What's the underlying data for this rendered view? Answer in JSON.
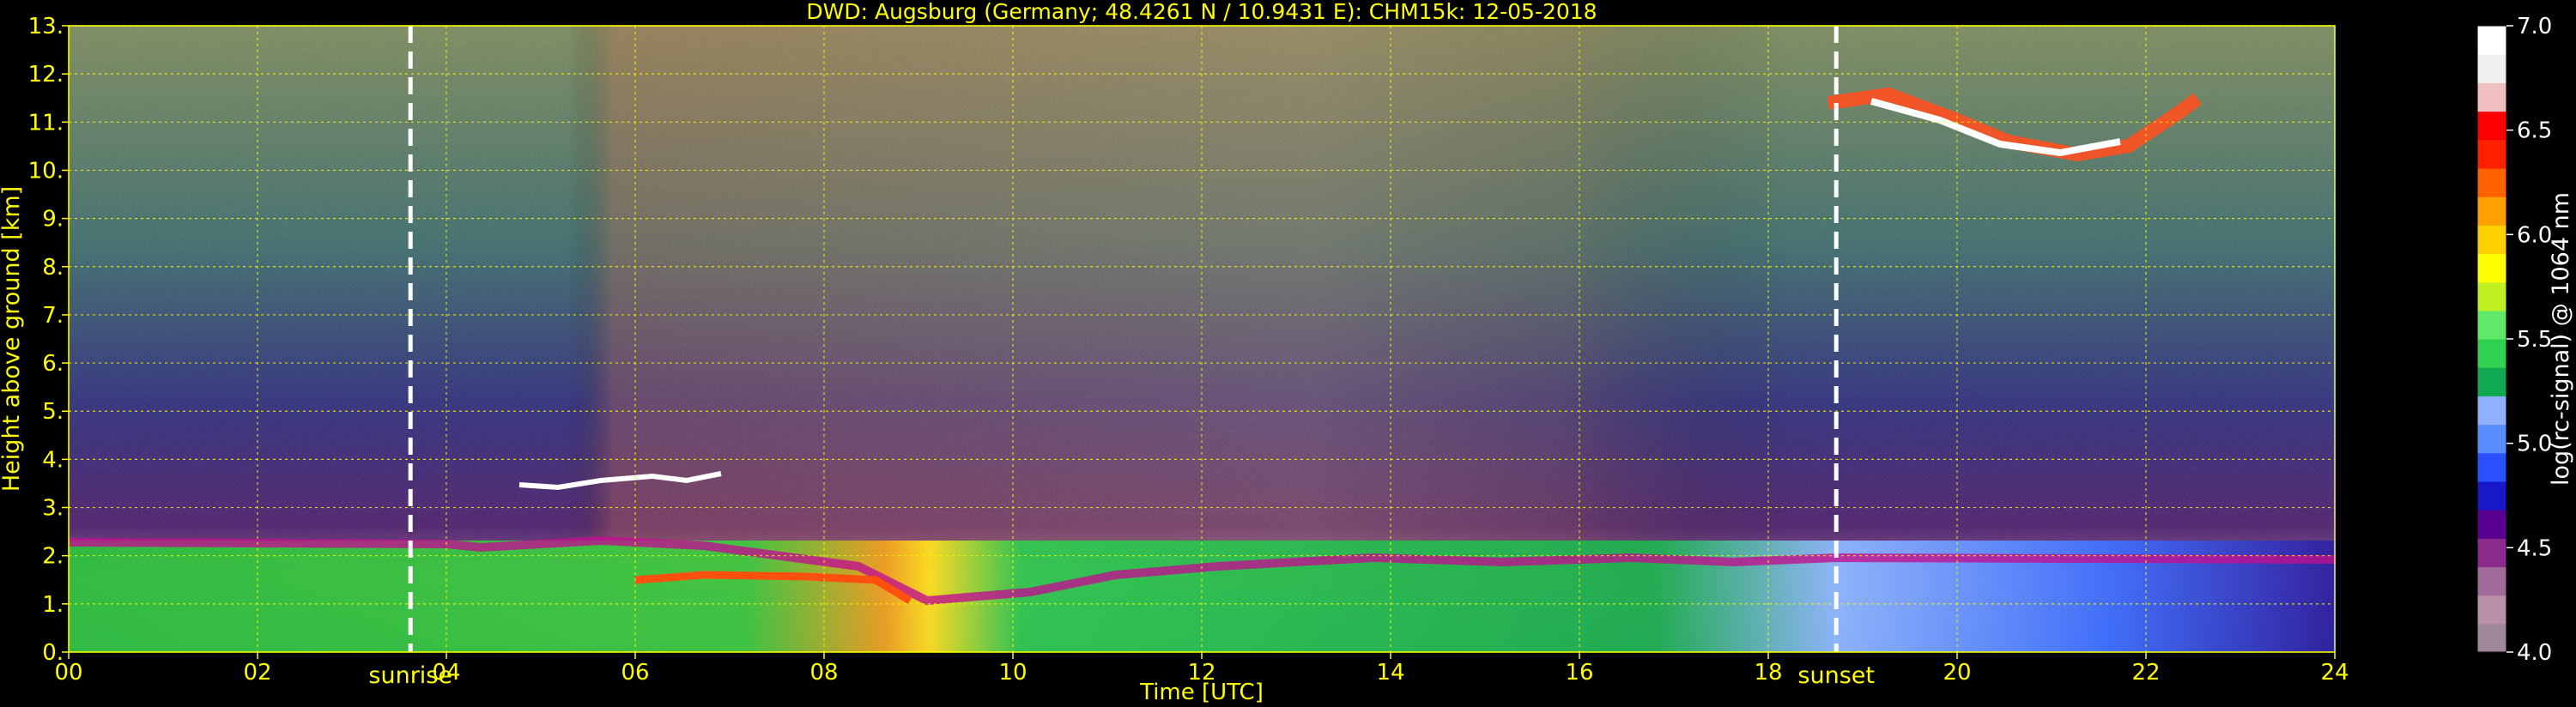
{
  "chart_data": {
    "type": "heatmap",
    "title": "DWD: Augsburg (Germany; 48.4261 N / 10.9431 E):    CHM15k: 12-05-2018",
    "xlabel": "Time [UTC]",
    "ylabel": "Height above ground [km]",
    "colorbar_label": "log(rc-signal) @ 1064 nm",
    "xlim": [
      0,
      24
    ],
    "ylim": [
      0,
      13
    ],
    "x_ticks": [
      "00",
      "02",
      "04",
      "06",
      "08",
      "10",
      "12",
      "14",
      "16",
      "18",
      "20",
      "22",
      "24"
    ],
    "y_ticks": [
      "0.",
      "1.",
      "2.",
      "3.",
      "4.",
      "5.",
      "6.",
      "7.",
      "8.",
      "9.",
      "10.",
      "11.",
      "12.",
      "13."
    ],
    "colorbar_range": [
      4.0,
      7.0
    ],
    "colorbar_ticks": [
      "4.0",
      "4.5",
      "5.0",
      "5.5",
      "6.0",
      "6.5",
      "7.0"
    ],
    "grid": true,
    "annotations": [
      {
        "label": "sunrise",
        "x": 3.62
      },
      {
        "label": "sunset",
        "x": 18.72
      }
    ],
    "colors": {
      "text": "#ffff00",
      "grid": "#ffff00",
      "background": "#000000",
      "marker_line": "#ffffff",
      "colorbar_label": "#ffffff"
    },
    "colorscale": [
      "#a08898",
      "#b890a8",
      "#a06a9a",
      "#8a2a8a",
      "#5a0090",
      "#1818c8",
      "#2a50ff",
      "#5a8cff",
      "#90b0ff",
      "#10a850",
      "#30d050",
      "#60e868",
      "#c0f020",
      "#ffff00",
      "#ffd000",
      "#ffa000",
      "#ff6000",
      "#ff2000",
      "#ff0000",
      "#f0c0c0",
      "#f0f0f0",
      "#ffffff"
    ]
  }
}
